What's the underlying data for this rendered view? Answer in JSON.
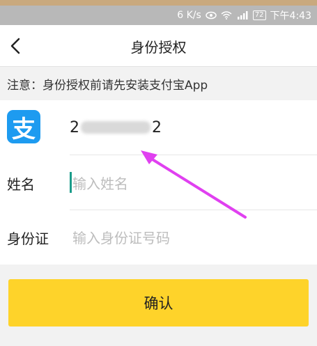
{
  "status_bar": {
    "speed": "6 K/s",
    "battery": "72",
    "time": "下午4:43"
  },
  "nav": {
    "title": "身份授权"
  },
  "notice": {
    "text": "注意：身份授权前请先安装支付宝App"
  },
  "alipay": {
    "logo_char": "支",
    "account_prefix": "2",
    "account_suffix": "2"
  },
  "form": {
    "name_label": "姓名",
    "name_placeholder": "输入姓名",
    "name_value": "",
    "id_label": "身份证",
    "id_placeholder": "输入身份证号码",
    "id_value": ""
  },
  "confirm": {
    "label": "确认"
  },
  "colors": {
    "accent": "#fed32a",
    "alipay_blue": "#1d9bf0",
    "arrow": "#e040f0"
  }
}
